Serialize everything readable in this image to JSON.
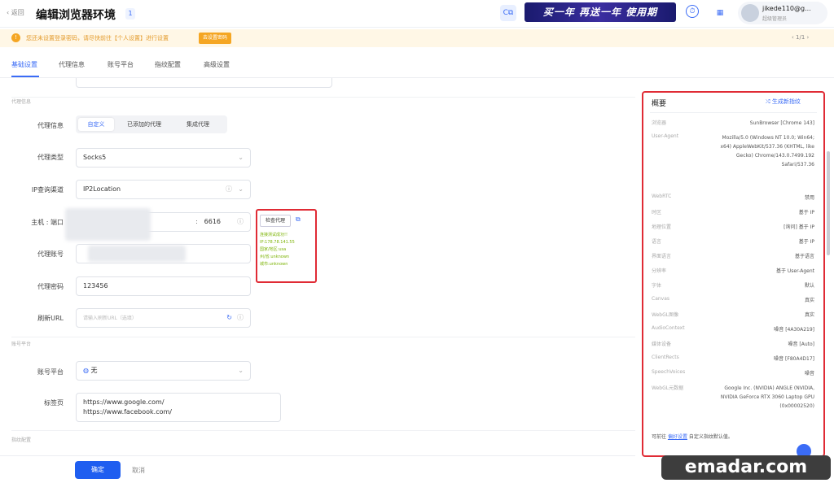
{
  "header": {
    "back_label": "返回",
    "title": "编辑浏览器环境",
    "title_badge": "1",
    "promo_text": "买一年 再送一年 使用期",
    "user_name": "jikede110@g...",
    "user_role": "超级管理员"
  },
  "notice": {
    "text": "您还未设置登录密码，请尽快前往【个人设置】进行设置",
    "button": "去设置密码",
    "pager": "1/1"
  },
  "tabs": [
    "基础设置",
    "代理信息",
    "账号平台",
    "指纹配置",
    "高级设置"
  ],
  "form": {
    "section_proxy": "代理信息",
    "proxy_info_label": "代理信息",
    "proxy_modes": [
      "自定义",
      "已添加的代理",
      "集成代理"
    ],
    "proxy_type_label": "代理类型",
    "proxy_type_value": "Socks5",
    "ip_channel_label": "IP查询渠道",
    "ip_channel_value": "IP2Location",
    "host_label": "主机 : 端口",
    "port_value": "6616",
    "proxy_account_label": "代理账号",
    "proxy_password_label": "代理密码",
    "proxy_password_value": "123456",
    "refresh_url_label": "刷新URL",
    "refresh_url_placeholder": "请输入刷新URL（选填）",
    "check_button": "检查代理",
    "check_result": [
      "连接测试成功!!",
      "IP:178.78.141.55",
      "国家/地区:usa",
      "州/省:unknown",
      "城市:unknown"
    ],
    "section_platform": "账号平台",
    "platform_label": "账号平台",
    "platform_value": "无",
    "tabs_label": "标签页",
    "tabs_value": [
      "https://www.google.com/",
      "https://www.facebook.com/"
    ],
    "section_fingerprint": "指纹配置",
    "ok_button": "确定",
    "cancel_button": "取消"
  },
  "summary": {
    "title": "概要",
    "new_fingerprint": "生成新指纹",
    "rows": [
      {
        "k": "浏览器",
        "v": "SunBrowser [Chrome 143]"
      },
      {
        "k": "User-Agent",
        "v": "Mozilla/5.0 (Windows NT 10.0; Win64; x64) AppleWebKit/537.36 (KHTML, like Gecko) Chrome/143.0.7499.192 Safari/537.36"
      },
      {
        "k": "WebRTC",
        "v": "禁用"
      },
      {
        "k": "时区",
        "v": "基于 IP"
      },
      {
        "k": "地理位置",
        "v": "[询问] 基于 IP"
      },
      {
        "k": "语言",
        "v": "基于 IP"
      },
      {
        "k": "界面语言",
        "v": "基于语言"
      },
      {
        "k": "分辨率",
        "v": "基于 User-Agent"
      },
      {
        "k": "字体",
        "v": "默认"
      },
      {
        "k": "Canvas",
        "v": "真实"
      },
      {
        "k": "WebGL图像",
        "v": "真实"
      },
      {
        "k": "AudioContext",
        "v": "噪音 [4A30A219]"
      },
      {
        "k": "媒体设备",
        "v": "噪音 [Auto]"
      },
      {
        "k": "ClientRects",
        "v": "噪音 [F80A4D17]"
      },
      {
        "k": "SpeechVoices",
        "v": "噪音"
      },
      {
        "k": "WebGL元数据",
        "v": "Google Inc. (NVIDIA) ANGLE (NVIDIA, NVIDIA GeForce RTX 3060 Laptop GPU (0x00002520)"
      }
    ],
    "foot_prefix": "可前往",
    "foot_link": "偏好设置",
    "foot_suffix": "自定义指纹默认值。"
  },
  "watermark": "emadar.com"
}
